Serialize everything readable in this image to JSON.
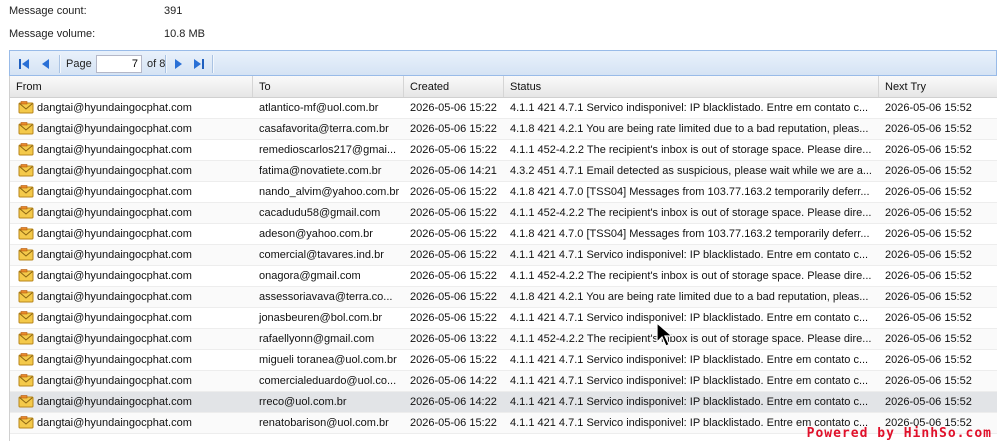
{
  "stats": {
    "message_count_label": "Message count:",
    "message_count_value": "391",
    "message_volume_label": "Message volume:",
    "message_volume_value": "10.8 MB"
  },
  "pager": {
    "page_label": "Page",
    "page_value": "7",
    "of_label": "of 8"
  },
  "columns": {
    "from": "From",
    "to": "To",
    "created": "Created",
    "status": "Status",
    "next_try": "Next Try"
  },
  "rows": [
    {
      "from": "dangtai@hyundaingocphat.com",
      "to": "atlantico-mf@uol.com.br",
      "created": "2026-05-06 15:22",
      "status": "4.1.1 421 4.7.1 Servico indisponivel: IP blacklistado. Entre em contato c...",
      "next_try": "2026-05-06 15:52"
    },
    {
      "from": "dangtai@hyundaingocphat.com",
      "to": "casafavorita@terra.com.br",
      "created": "2026-05-06 15:22",
      "status": "4.1.8 421 4.2.1 You are being rate limited due to a bad reputation, pleas...",
      "next_try": "2026-05-06 15:52"
    },
    {
      "from": "dangtai@hyundaingocphat.com",
      "to": "remedioscarlos217@gmai...",
      "created": "2026-05-06 15:22",
      "status": "4.1.1 452-4.2.2 The recipient's inbox is out of storage space. Please dire...",
      "next_try": "2026-05-06 15:52"
    },
    {
      "from": "dangtai@hyundaingocphat.com",
      "to": "fatima@novatiete.com.br",
      "created": "2026-05-06 14:21",
      "status": "4.3.2 451 4.7.1 Email detected as suspicious, please wait while we are a...",
      "next_try": "2026-05-06 15:52"
    },
    {
      "from": "dangtai@hyundaingocphat.com",
      "to": "nando_alvim@yahoo.com.br",
      "created": "2026-05-06 15:22",
      "status": "4.1.8 421 4.7.0 [TSS04] Messages from 103.77.163.2 temporarily deferr...",
      "next_try": "2026-05-06 15:52"
    },
    {
      "from": "dangtai@hyundaingocphat.com",
      "to": "cacadudu58@gmail.com",
      "created": "2026-05-06 15:22",
      "status": "4.1.1 452-4.2.2 The recipient's inbox is out of storage space. Please dire...",
      "next_try": "2026-05-06 15:52"
    },
    {
      "from": "dangtai@hyundaingocphat.com",
      "to": "adeson@yahoo.com.br",
      "created": "2026-05-06 15:22",
      "status": "4.1.8 421 4.7.0 [TSS04] Messages from 103.77.163.2 temporarily deferr...",
      "next_try": "2026-05-06 15:52"
    },
    {
      "from": "dangtai@hyundaingocphat.com",
      "to": "comercial@tavares.ind.br",
      "created": "2026-05-06 15:22",
      "status": "4.1.1 421 4.7.1 Servico indisponivel: IP blacklistado. Entre em contato c...",
      "next_try": "2026-05-06 15:52"
    },
    {
      "from": "dangtai@hyundaingocphat.com",
      "to": "onagora@gmail.com",
      "created": "2026-05-06 15:22",
      "status": "4.1.1 452-4.2.2 The recipient's inbox is out of storage space. Please dire...",
      "next_try": "2026-05-06 15:52"
    },
    {
      "from": "dangtai@hyundaingocphat.com",
      "to": "assessoriavava@terra.co...",
      "created": "2026-05-06 15:22",
      "status": "4.1.8 421 4.2.1 You are being rate limited due to a bad reputation, pleas...",
      "next_try": "2026-05-06 15:52"
    },
    {
      "from": "dangtai@hyundaingocphat.com",
      "to": "jonasbeuren@bol.com.br",
      "created": "2026-05-06 15:22",
      "status": "4.1.1 421 4.7.1 Servico indisponivel: IP blacklistado. Entre em contato c...",
      "next_try": "2026-05-06 15:52"
    },
    {
      "from": "dangtai@hyundaingocphat.com",
      "to": "rafaellyonn@gmail.com",
      "created": "2026-05-06 13:22",
      "status": "4.1.1 452-4.2.2 The recipient's inbox is out of storage space. Please dire...",
      "next_try": "2026-05-06 15:52"
    },
    {
      "from": "dangtai@hyundaingocphat.com",
      "to": "migueli toranea@uol.com.br",
      "created": "2026-05-06 15:22",
      "status": "4.1.1 421 4.7.1 Servico indisponivel: IP blacklistado. Entre em contato c...",
      "next_try": "2026-05-06 15:52"
    },
    {
      "from": "dangtai@hyundaingocphat.com",
      "to": "comercialeduardo@uol.co...",
      "created": "2026-05-06 14:22",
      "status": "4.1.1 421 4.7.1 Servico indisponivel: IP blacklistado. Entre em contato c...",
      "next_try": "2026-05-06 15:52"
    },
    {
      "from": "dangtai@hyundaingocphat.com",
      "to": "rreco@uol.com.br",
      "created": "2026-05-06 14:22",
      "status": "4.1.1 421 4.7.1 Servico indisponivel: IP blacklistado. Entre em contato c...",
      "next_try": "2026-05-06 15:52"
    },
    {
      "from": "dangtai@hyundaingocphat.com",
      "to": "renatobarison@uol.com.br",
      "created": "2026-05-06 15:22",
      "status": "4.1.1 421 4.7.1 Servico indisponivel: IP blacklistado. Entre em contato c...",
      "next_try": "2026-05-06 15:52"
    }
  ],
  "watermark": "Powered by HinhSo.com"
}
